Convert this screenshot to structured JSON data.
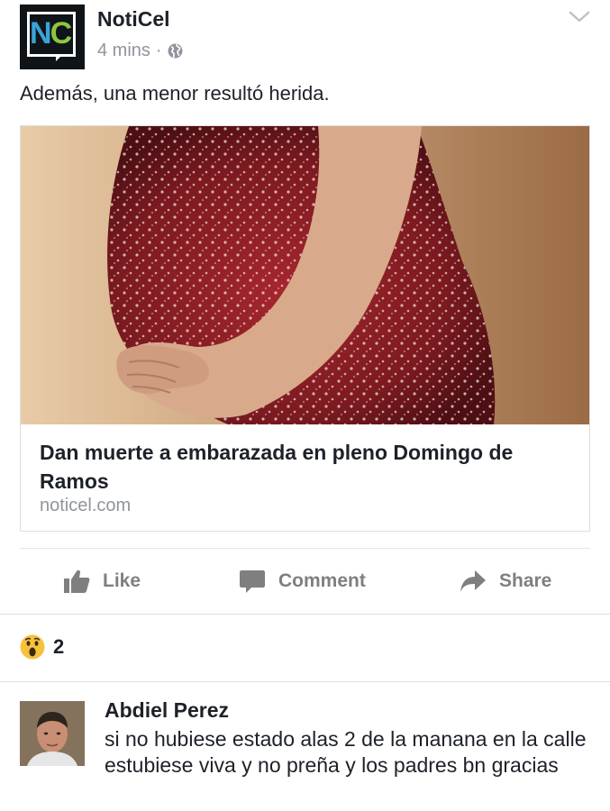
{
  "post": {
    "page_name": "NotiCel",
    "timestamp": "4 mins",
    "separator": "·",
    "privacy_icon": "globe-icon",
    "logo_letters": {
      "n": "N",
      "c": "C"
    },
    "text": "Además, una menor resultó herida."
  },
  "link": {
    "title": "Dan muerte a embarazada en pleno Domingo de Ramos",
    "domain": "noticel.com"
  },
  "actions": {
    "like": "Like",
    "comment": "Comment",
    "share": "Share"
  },
  "reactions": {
    "icon": "wow-icon",
    "count": "2"
  },
  "comment": {
    "author": "Abdiel Perez",
    "text": "si no hubiese estado alas 2 de la manana en la calle estubiese viva y no preña y los padres bn gracias"
  },
  "colors": {
    "text": "#1d2129",
    "secondary": "#90949c",
    "action": "#7f7f7f",
    "logo_n": "#3aa3d9",
    "logo_c": "#8dc63f"
  }
}
